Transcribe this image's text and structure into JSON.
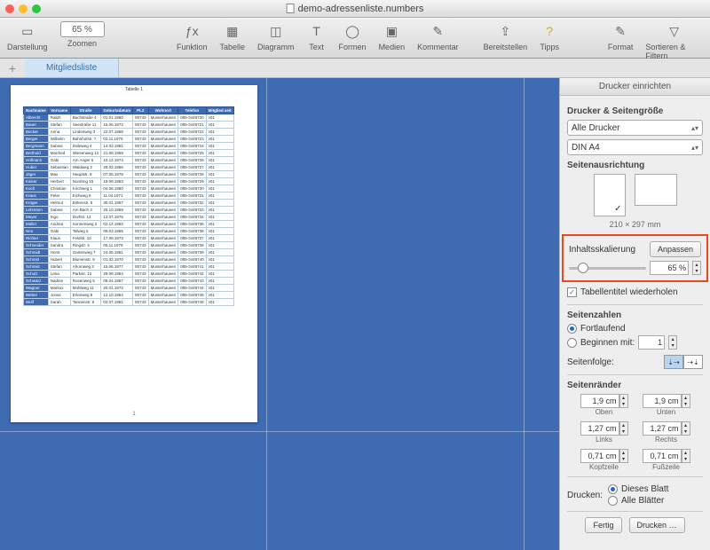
{
  "window": {
    "title": "demo-adressenliste.numbers"
  },
  "toolbar": {
    "darstellung": "Darstellung",
    "zoom_value": "65 %",
    "zoom_label": "Zoomen",
    "funktion": "Funktion",
    "tabelle": "Tabelle",
    "diagramm": "Diagramm",
    "text": "Text",
    "formen": "Formen",
    "medien": "Medien",
    "kommentar": "Kommentar",
    "bereitstellen": "Bereitstellen",
    "tipps": "Tipps",
    "format": "Format",
    "sortfilter": "Sortieren & Filtern"
  },
  "tabs": {
    "mitgliedsliste": "Mitgliedsliste"
  },
  "sheet": {
    "table_title": "Tabelle 1",
    "page_number": "1",
    "headers": [
      "Nachname",
      "Vorname",
      "Straße",
      "Geburtsdatum",
      "PLZ",
      "Wohnort",
      "Telefon",
      "Mitglied seit"
    ],
    "rows": [
      [
        "Albrecht",
        "Ralph",
        "Bachstraße 4",
        "01.01.1960",
        "80743",
        "Musterhausen",
        "089-3449720",
        "v01"
      ],
      [
        "Bauer",
        "Stefan",
        "Seestraße 11",
        "16.05.1972",
        "80743",
        "Musterhausen",
        "089-3449721",
        "v01"
      ],
      [
        "Becker",
        "Anna",
        "Lindenweg 3",
        "22.07.1968",
        "80743",
        "Musterhausen",
        "089-3449722",
        "v01"
      ],
      [
        "Berger",
        "Wilhelm",
        "Bahnhofstr. 7",
        "03.11.1975",
        "80743",
        "Musterhausen",
        "089-3449723",
        "v01"
      ],
      [
        "Bergmann",
        "Sabine",
        "Zeileweg 4",
        "14.03.1981",
        "80743",
        "Musterhausen",
        "089-3449724",
        "v01"
      ],
      [
        "Berthold",
        "Manfred",
        "Wiesenweg 12",
        "21.08.1959",
        "80743",
        "Musterhausen",
        "089-3449725",
        "v01"
      ],
      [
        "Hofmann",
        "Gabi",
        "Am Anger 6",
        "10.12.1974",
        "80743",
        "Musterhausen",
        "089-3449726",
        "v01"
      ],
      [
        "Huber",
        "Sebastian",
        "Waldweg 2",
        "28.02.1966",
        "80743",
        "Musterhausen",
        "089-3449727",
        "v01"
      ],
      [
        "Jäger",
        "Max",
        "Hauptstr. 9",
        "07.05.1978",
        "80743",
        "Musterhausen",
        "089-3449728",
        "v01"
      ],
      [
        "Kaiser",
        "Herbert",
        "Nordring 15",
        "19.09.1963",
        "80743",
        "Musterhausen",
        "089-3449729",
        "v01"
      ],
      [
        "Koch",
        "Christian",
        "Kirchweg 1",
        "04.06.1980",
        "80743",
        "Musterhausen",
        "089-3449730",
        "v01"
      ],
      [
        "Kraus",
        "Peter",
        "Eichweg 8",
        "11.04.1971",
        "80743",
        "Musterhausen",
        "089-3449731",
        "v01"
      ],
      [
        "Krüger",
        "Helmut",
        "Birkenstr. 5",
        "30.01.1957",
        "80743",
        "Musterhausen",
        "089-3449732",
        "v01"
      ],
      [
        "Lehmann",
        "Sabine",
        "Am Bach 3",
        "25.10.1969",
        "80743",
        "Musterhausen",
        "089-3449733",
        "v01"
      ],
      [
        "Meyer",
        "Ingo",
        "Dorfstr. 14",
        "13.07.1976",
        "80743",
        "Musterhausen",
        "089-3449734",
        "v01"
      ],
      [
        "Müller",
        "Andrea",
        "Sonnenweg 2",
        "02.12.1982",
        "80743",
        "Musterhausen",
        "089-3449735",
        "v01"
      ],
      [
        "Neu",
        "Gabi",
        "Talweg 6",
        "09.03.1965",
        "80743",
        "Musterhausen",
        "089-3449736",
        "v01"
      ],
      [
        "Richter",
        "Klaus",
        "Feldstr. 10",
        "17.08.1973",
        "80743",
        "Musterhausen",
        "089-3449737",
        "v01"
      ],
      [
        "Schneider",
        "Sandra",
        "Ringstr. 4",
        "06.11.1979",
        "80743",
        "Musterhausen",
        "089-3449738",
        "v01"
      ],
      [
        "Schmidt",
        "Horst",
        "Gartenweg 7",
        "24.05.1961",
        "80743",
        "Musterhausen",
        "089-3449739",
        "v01"
      ],
      [
        "Schmitt",
        "Hubert",
        "Blumenstr. 9",
        "01.02.1970",
        "80743",
        "Musterhausen",
        "089-3449740",
        "v01"
      ],
      [
        "Schmitz",
        "Stefan",
        "Ahornweg 3",
        "15.06.1977",
        "80743",
        "Musterhausen",
        "089-3449741",
        "v01"
      ],
      [
        "Schulz",
        "Lena",
        "Parkstr. 12",
        "29.09.1984",
        "80743",
        "Musterhausen",
        "089-3449742",
        "v01"
      ],
      [
        "Schwarz",
        "Nadine",
        "Rosenweg 5",
        "08.04.1967",
        "80743",
        "Musterhausen",
        "089-3449743",
        "v01"
      ],
      [
        "Wagner",
        "Markus",
        "Mühlweg 11",
        "20.01.1972",
        "80743",
        "Musterhausen",
        "089-3449744",
        "v01"
      ],
      [
        "Weber",
        "Jonas",
        "Erlenweg 8",
        "12.10.1964",
        "80743",
        "Musterhausen",
        "089-3449745",
        "v01"
      ],
      [
        "Wolf",
        "Sarah",
        "Tannenstr. 6",
        "03.07.1981",
        "80743",
        "Musterhausen",
        "089-3449746",
        "v01"
      ]
    ]
  },
  "side": {
    "title": "Drucker einrichten",
    "printer_size": "Drucker & Seitengröße",
    "printer_sel": "Alle Drucker",
    "paper_sel": "DIN A4",
    "orientation": "Seitenausrichtung",
    "dim": "210 × 297 mm",
    "scaling_label": "Inhaltsskalierung",
    "fit_btn": "Anpassen",
    "scale_val": "65 %",
    "repeat_headers": "Tabellentitel wiederholen",
    "page_numbers": "Seitenzahlen",
    "continuous": "Fortlaufend",
    "start_with": "Beginnen mit:",
    "start_val": "1",
    "page_order": "Seitenfolge:",
    "margins": "Seitenränder",
    "top_v": "1,9 cm",
    "top_l": "Oben",
    "bot_v": "1,9 cm",
    "bot_l": "Unten",
    "left_v": "1,27 cm",
    "left_l": "Links",
    "right_v": "1,27 cm",
    "right_l": "Rechts",
    "head_v": "0,71 cm",
    "head_l": "Kopfzeile",
    "foot_v": "0,71 cm",
    "foot_l": "Fußzeile",
    "print_lbl": "Drucken:",
    "this_sheet": "Dieses Blatt",
    "all_sheets": "Alle Blätter",
    "done": "Fertig",
    "print_btn": "Drucken …"
  }
}
